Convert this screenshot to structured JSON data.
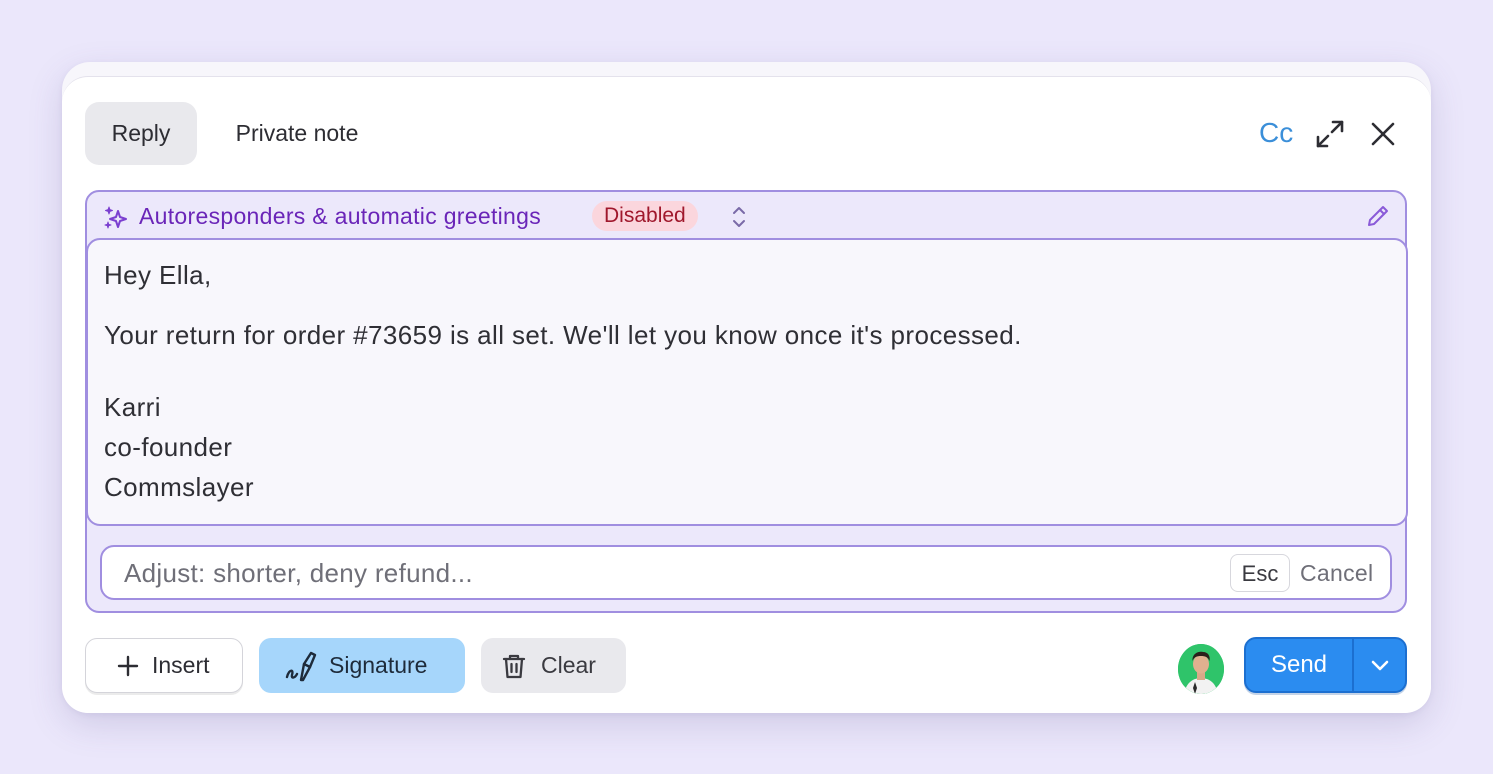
{
  "header": {
    "tabs": [
      {
        "label": "Reply",
        "active": true
      },
      {
        "label": "Private note",
        "active": false
      }
    ],
    "cc_label": "Cc",
    "expand_icon": "expand-icon",
    "close_icon": "close-icon"
  },
  "autoresponder": {
    "label": "Autoresponders & automatic greetings",
    "status": "Disabled",
    "icon": "sparkle-icon"
  },
  "message": {
    "greeting": "Hey Ella,",
    "body": "Your return for order #73659 is all set. We'll let you know once it's processed.",
    "signature": [
      "Karri",
      "co-founder",
      "Commslayer"
    ]
  },
  "adjust": {
    "placeholder": "Adjust: shorter, deny refund...",
    "value": "",
    "esc_key": "Esc",
    "cancel_label": "Cancel"
  },
  "footer": {
    "insert_label": "Insert",
    "signature_label": "Signature",
    "clear_label": "Clear",
    "send_label": "Send"
  },
  "colors": {
    "background": "#ebe7fb",
    "accent_purple": "#6a25b8",
    "panel_border": "#a08ee0",
    "badge_bg": "#fbd6dd",
    "badge_text": "#a0182c",
    "send_blue": "#2b8cf0",
    "signature_bg": "#a6d6fb",
    "cc_blue": "#3b8fd9"
  }
}
